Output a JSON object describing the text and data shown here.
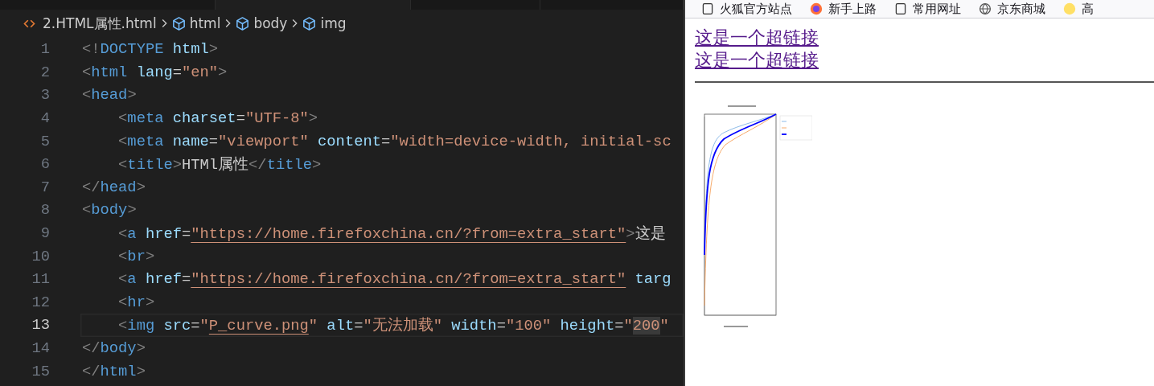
{
  "editor": {
    "breadcrumbs": [
      {
        "kind": "file",
        "label": "2.HTML属性.html"
      },
      {
        "kind": "element",
        "label": "html"
      },
      {
        "kind": "element",
        "label": "body"
      },
      {
        "kind": "element",
        "label": "img"
      }
    ],
    "lines": [
      {
        "number": "1",
        "selected": false,
        "tokens": [
          {
            "kind": "punct",
            "text": "<!"
          },
          {
            "kind": "tag",
            "text": "DOCTYPE"
          },
          {
            "kind": "attr",
            "text": " html"
          },
          {
            "kind": "punct",
            "text": ">"
          }
        ]
      },
      {
        "number": "2",
        "selected": false,
        "tokens": [
          {
            "kind": "punct",
            "text": "<"
          },
          {
            "kind": "tag",
            "text": "html"
          },
          {
            "kind": "attr",
            "text": " lang"
          },
          {
            "kind": "text",
            "text": "="
          },
          {
            "kind": "str",
            "text": "\"en\""
          },
          {
            "kind": "punct",
            "text": ">"
          }
        ]
      },
      {
        "number": "3",
        "selected": false,
        "tokens": [
          {
            "kind": "punct",
            "text": "<"
          },
          {
            "kind": "tag",
            "text": "head"
          },
          {
            "kind": "punct",
            "text": ">"
          }
        ]
      },
      {
        "number": "4",
        "selected": false,
        "tokens": [
          {
            "kind": "punct",
            "text": "    <"
          },
          {
            "kind": "tag",
            "text": "meta"
          },
          {
            "kind": "attr",
            "text": " charset"
          },
          {
            "kind": "text",
            "text": "="
          },
          {
            "kind": "str",
            "text": "\"UTF-8\""
          },
          {
            "kind": "punct",
            "text": ">"
          }
        ]
      },
      {
        "number": "5",
        "selected": false,
        "tokens": [
          {
            "kind": "punct",
            "text": "    <"
          },
          {
            "kind": "tag",
            "text": "meta"
          },
          {
            "kind": "attr",
            "text": " name"
          },
          {
            "kind": "text",
            "text": "="
          },
          {
            "kind": "str",
            "text": "\"viewport\""
          },
          {
            "kind": "attr",
            "text": " content"
          },
          {
            "kind": "text",
            "text": "="
          },
          {
            "kind": "str",
            "text": "\"width=device-width, initial-sc"
          }
        ]
      },
      {
        "number": "6",
        "selected": false,
        "tokens": [
          {
            "kind": "punct",
            "text": "    <"
          },
          {
            "kind": "tag",
            "text": "title"
          },
          {
            "kind": "punct",
            "text": ">"
          },
          {
            "kind": "text",
            "text": "HTMl属性"
          },
          {
            "kind": "punct",
            "text": "</"
          },
          {
            "kind": "tag",
            "text": "title"
          },
          {
            "kind": "punct",
            "text": ">"
          }
        ]
      },
      {
        "number": "7",
        "selected": false,
        "tokens": [
          {
            "kind": "punct",
            "text": "</"
          },
          {
            "kind": "tag",
            "text": "head"
          },
          {
            "kind": "punct",
            "text": ">"
          }
        ]
      },
      {
        "number": "8",
        "selected": false,
        "tokens": [
          {
            "kind": "punct",
            "text": "<"
          },
          {
            "kind": "tag",
            "text": "body"
          },
          {
            "kind": "punct",
            "text": ">"
          }
        ]
      },
      {
        "number": "9",
        "selected": false,
        "tokens": [
          {
            "kind": "punct",
            "text": "    <"
          },
          {
            "kind": "tag",
            "text": "a"
          },
          {
            "kind": "attr",
            "text": " href"
          },
          {
            "kind": "text",
            "text": "="
          },
          {
            "kind": "str",
            "text": "\"https://home.firefoxchina.cn/?from=extra_start\"",
            "linked": true
          },
          {
            "kind": "punct",
            "text": ">"
          },
          {
            "kind": "text",
            "text": "这是"
          }
        ]
      },
      {
        "number": "10",
        "selected": false,
        "tokens": [
          {
            "kind": "punct",
            "text": "    <"
          },
          {
            "kind": "tag",
            "text": "br"
          },
          {
            "kind": "punct",
            "text": ">"
          }
        ]
      },
      {
        "number": "11",
        "selected": false,
        "tokens": [
          {
            "kind": "punct",
            "text": "    <"
          },
          {
            "kind": "tag",
            "text": "a"
          },
          {
            "kind": "attr",
            "text": " href"
          },
          {
            "kind": "text",
            "text": "="
          },
          {
            "kind": "str",
            "text": "\"https://home.firefoxchina.cn/?from=extra_start\"",
            "linked": true
          },
          {
            "kind": "attr",
            "text": " targ"
          }
        ]
      },
      {
        "number": "12",
        "selected": false,
        "tokens": [
          {
            "kind": "punct",
            "text": "    <"
          },
          {
            "kind": "tag",
            "text": "hr"
          },
          {
            "kind": "punct",
            "text": ">"
          }
        ]
      },
      {
        "number": "13",
        "selected": true,
        "tokens": [
          {
            "kind": "punct",
            "text": "    <"
          },
          {
            "kind": "tag",
            "text": "img"
          },
          {
            "kind": "attr",
            "text": " src"
          },
          {
            "kind": "text",
            "text": "="
          },
          {
            "kind": "str",
            "text": "\""
          },
          {
            "kind": "str",
            "text": "P_curve.png",
            "linked": true
          },
          {
            "kind": "str",
            "text": "\""
          },
          {
            "kind": "attr",
            "text": " alt"
          },
          {
            "kind": "text",
            "text": "="
          },
          {
            "kind": "str",
            "text": "\"无法加载\""
          },
          {
            "kind": "attr",
            "text": " width"
          },
          {
            "kind": "text",
            "text": "="
          },
          {
            "kind": "str",
            "text": "\"100\""
          },
          {
            "kind": "attr",
            "text": " height"
          },
          {
            "kind": "text",
            "text": "="
          },
          {
            "kind": "str",
            "text": "\""
          },
          {
            "kind": "str",
            "text": "200",
            "highlighted": true
          },
          {
            "kind": "str",
            "text": "\""
          }
        ]
      },
      {
        "number": "14",
        "selected": false,
        "tokens": [
          {
            "kind": "punct",
            "text": "</"
          },
          {
            "kind": "tag",
            "text": "body"
          },
          {
            "kind": "punct",
            "text": ">"
          }
        ]
      },
      {
        "number": "15",
        "selected": false,
        "tokens": [
          {
            "kind": "punct",
            "text": "</"
          },
          {
            "kind": "tag",
            "text": "html"
          },
          {
            "kind": "punct",
            "text": ">"
          }
        ]
      }
    ]
  },
  "browser": {
    "bookmarks": [
      {
        "kind": "page",
        "label": "火狐官方站点"
      },
      {
        "kind": "firefox",
        "label": "新手上路"
      },
      {
        "kind": "page",
        "label": "常用网址"
      },
      {
        "kind": "globe",
        "label": "京东商城"
      },
      {
        "kind": "emoji",
        "label": "高"
      }
    ],
    "links": [
      "这是一个超链接",
      "这是一个超链接"
    ],
    "image": {
      "kind": "picture"
    }
  }
}
